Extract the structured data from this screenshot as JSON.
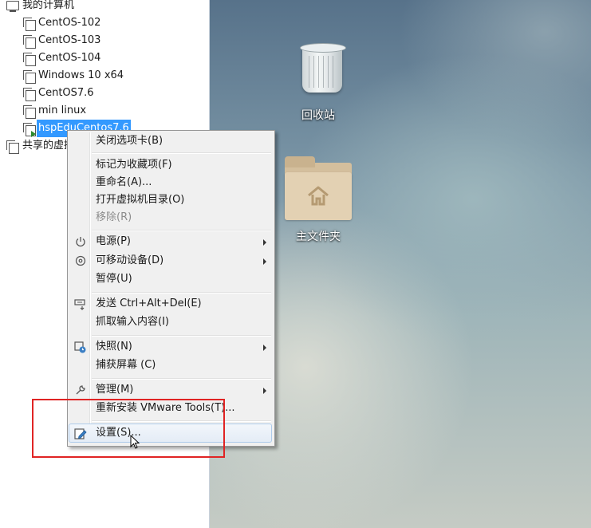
{
  "library": {
    "root_label": "我的计算机",
    "vms": [
      {
        "label": "CentOS-102"
      },
      {
        "label": "CentOS-103"
      },
      {
        "label": "CentOS-104"
      },
      {
        "label": "Windows 10 x64"
      },
      {
        "label": "CentOS7.6"
      },
      {
        "label": "min linux"
      },
      {
        "label": "hspEduCentos7.6",
        "selected": true,
        "running": true
      }
    ],
    "shared_label": "共享的虚拟机"
  },
  "desktop": {
    "icons": [
      {
        "label": "回收站",
        "icon": "recycle-bin-icon"
      },
      {
        "label": "主文件夹",
        "icon": "home-folder-icon"
      }
    ]
  },
  "context_menu": {
    "items": {
      "close_tab": "关闭选项卡(B)",
      "mark_favorite": "标记为收藏项(F)",
      "rename": "重命名(A)...",
      "open_dir": "打开虚拟机目录(O)",
      "remove": "移除(R)",
      "power": "电源(P)",
      "removable": "可移动设备(D)",
      "pause": "暂停(U)",
      "send_cad": "发送 Ctrl+Alt+Del(E)",
      "grab_input": "抓取输入内容(I)",
      "snapshot": "快照(N)",
      "capture_screen": "捕获屏幕 (C)",
      "manage": "管理(M)",
      "reinstall_tools": "重新安装 VMware Tools(T)...",
      "settings": "设置(S)..."
    }
  },
  "colors": {
    "selection": "#3399ff",
    "annotation": "#e02424",
    "menu_bg": "#f0f0f0"
  }
}
